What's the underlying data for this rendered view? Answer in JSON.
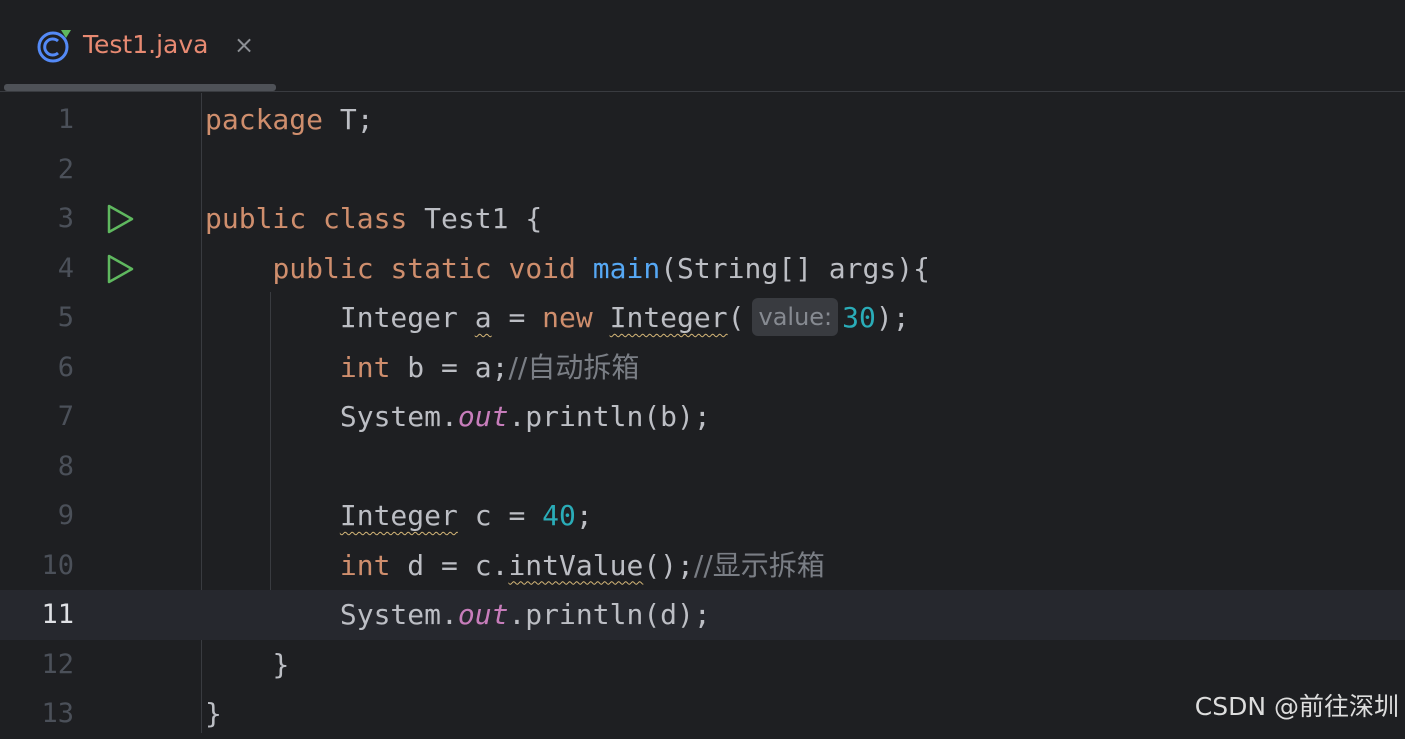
{
  "tab": {
    "title": "Test1.java",
    "close": "×"
  },
  "gutter": {
    "line_numbers": [
      "1",
      "2",
      "3",
      "4",
      "5",
      "6",
      "7",
      "8",
      "9",
      "10",
      "11",
      "12",
      "13"
    ],
    "current_line": "11"
  },
  "code": {
    "l1": {
      "kw": "package",
      "rest": " T;"
    },
    "l3": {
      "kw1": "public",
      "kw2": "class",
      "rest": " Test1 {"
    },
    "l4": {
      "indent": "    ",
      "kw1": "public",
      "kw2": "static",
      "kw3": "void",
      "fn": "main",
      "rest": "(String[] args){"
    },
    "l5": {
      "indent": "        ",
      "type": "Integer",
      "var": "a",
      "eq": " = ",
      "kw": "new",
      "cls": "Integer",
      "paren": "(",
      "hint": "value:",
      "num": "30",
      "end": ");"
    },
    "l6": {
      "indent": "        ",
      "kw": "int",
      "rest": " b = a;",
      "comment": "//自动拆箱"
    },
    "l7": {
      "indent": "        ",
      "obj": "System.",
      "field": "out",
      "rest": ".println(b);"
    },
    "l9": {
      "indent": "        ",
      "type": "Integer",
      "rest": " c = ",
      "num": "40",
      "end": ";"
    },
    "l10": {
      "indent": "        ",
      "kw": "int",
      "rest": " d = c.",
      "method": "intValue",
      "end": "();",
      "comment": "//显示拆箱"
    },
    "l11": {
      "indent": "        ",
      "obj": "System.",
      "field": "out",
      "rest": ".println(d);"
    },
    "l12": {
      "indent": "    ",
      "brace": "}"
    },
    "l13": {
      "brace": "}"
    }
  },
  "watermark": "CSDN @前往深圳",
  "colors": {
    "background": "#1e1f22",
    "keyword": "#cf8e6d",
    "function": "#56a8f5",
    "number": "#2aacb8",
    "static_field": "#c77dbb",
    "comment": "#7a7e85",
    "text": "#bcbec4",
    "run_icon": "#5fb85f",
    "tab_title": "#e88a72"
  },
  "icons": {
    "tab": "java-class-icon",
    "run": "run-play-icon"
  }
}
